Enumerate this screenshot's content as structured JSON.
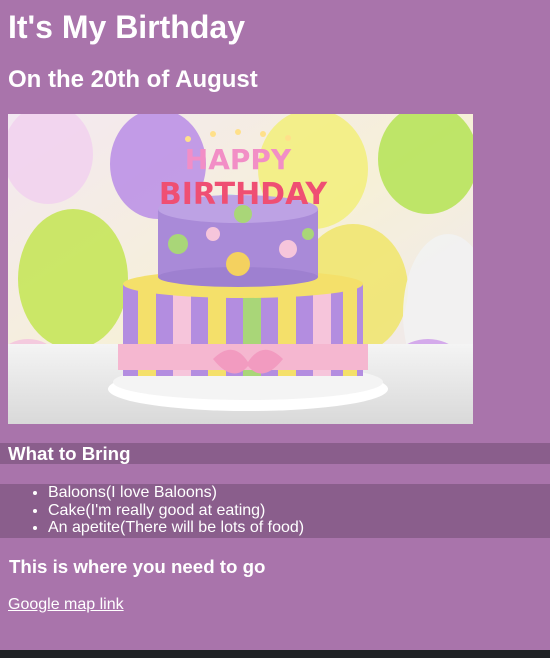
{
  "page": {
    "title": "It's My Birthday",
    "subtitle": "On the 20th of August"
  },
  "image": {
    "icon": "birthday-cake-photo",
    "candle_text": "HAPPY BIRTHDAY"
  },
  "bring": {
    "heading": "What to Bring",
    "items": [
      "Baloons(I love Baloons)",
      "Cake(I'm really good at eating)",
      "An apetite(There will be lots of food)"
    ]
  },
  "location": {
    "heading": "This is where you need to go",
    "link_text": "Google map link"
  },
  "colors": {
    "background": "#a974ab",
    "band": "#8a5e8c",
    "text": "#ffffff",
    "bottom_bar": "#202326"
  }
}
